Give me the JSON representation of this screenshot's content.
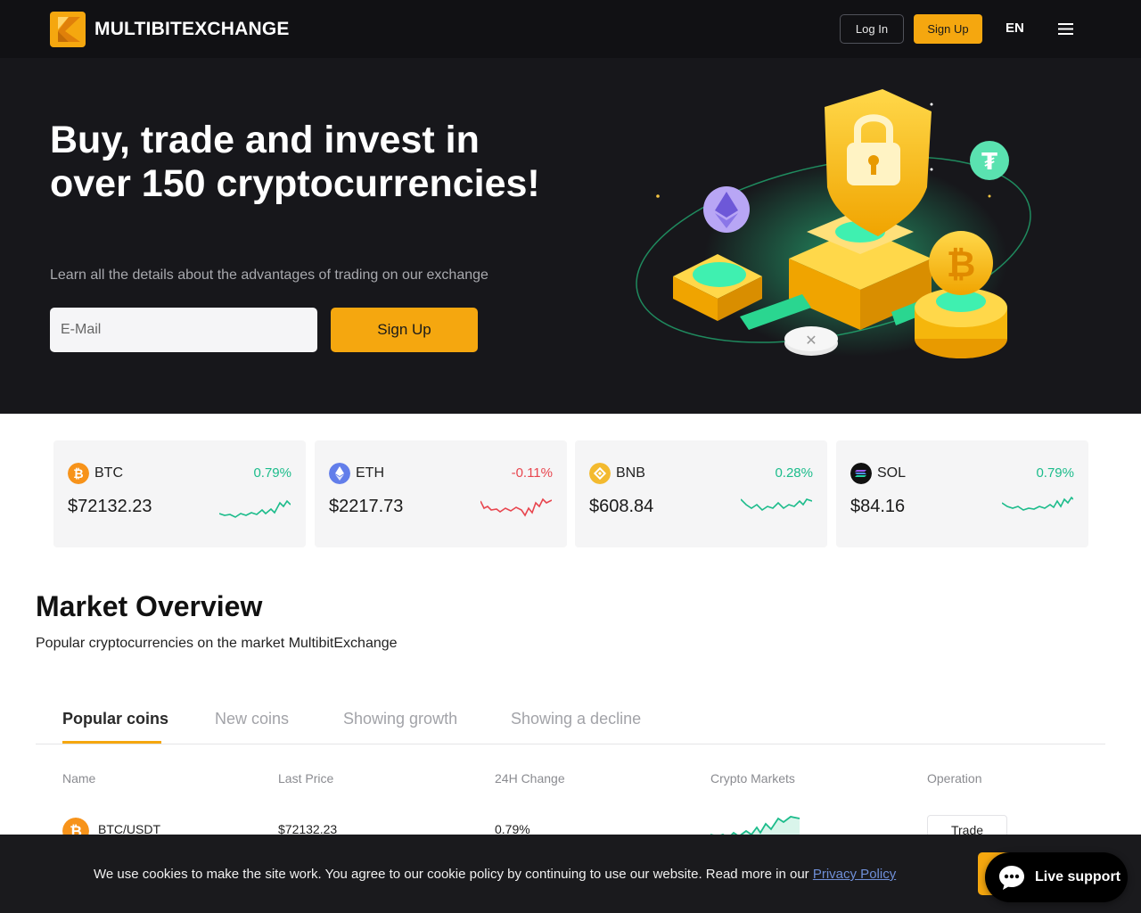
{
  "header": {
    "brand": "MULTIBITEXCHANGE",
    "login_label": "Log In",
    "signup_label": "Sign Up",
    "language": "EN",
    "logo_icon": "multibit-logo-icon",
    "menu_icon": "hamburger-menu-icon"
  },
  "hero": {
    "title": "Buy, trade and invest in over 150 cryptocurrencies!",
    "subtitle": "Learn all the details about the advantages of trading on our exchange",
    "email_placeholder": "E-Mail",
    "signup_label": "Sign Up",
    "illustration": "crypto-security-illustration"
  },
  "tickers": [
    {
      "symbol": "BTC",
      "change": "0.79%",
      "price": "$72132.23",
      "direction": "up",
      "icon": "bitcoin-icon",
      "color": "#f7931a"
    },
    {
      "symbol": "ETH",
      "change": "-0.11%",
      "price": "$2217.73",
      "direction": "down",
      "icon": "ethereum-icon",
      "color": "#627eea"
    },
    {
      "symbol": "BNB",
      "change": "0.28%",
      "price": "$608.84",
      "direction": "up",
      "icon": "bnb-icon",
      "color": "#f3ba2f"
    },
    {
      "symbol": "SOL",
      "change": "0.79%",
      "price": "$84.16",
      "direction": "up",
      "icon": "solana-icon",
      "color": "#111111"
    }
  ],
  "market": {
    "title": "Market Overview",
    "subtitle": "Popular cryptocurrencies on the market MultibitExchange",
    "tabs": [
      "Popular coins",
      "New coins",
      "Showing growth",
      "Showing a decline"
    ],
    "active_tab": "Popular coins",
    "columns": [
      "Name",
      "Last Price",
      "24H Change",
      "Crypto Markets",
      "Operation"
    ],
    "rows": [
      {
        "pair": "BTC/USDT",
        "last_price": "$72132.23",
        "change": "0.79%",
        "operation": "Trade",
        "icon": "bitcoin-icon"
      }
    ]
  },
  "cookie": {
    "text": "We use cookies to make the site work. You agree to our cookie policy by continuing to use our website. Read more in our ",
    "link_text": "Privacy Policy"
  },
  "support": {
    "label": "Live support",
    "icon": "chat-bubble-icon"
  },
  "colors": {
    "accent": "#f5a70f",
    "up": "#1cbc8b",
    "down": "#e8464f",
    "dark_bg": "#17171b"
  }
}
